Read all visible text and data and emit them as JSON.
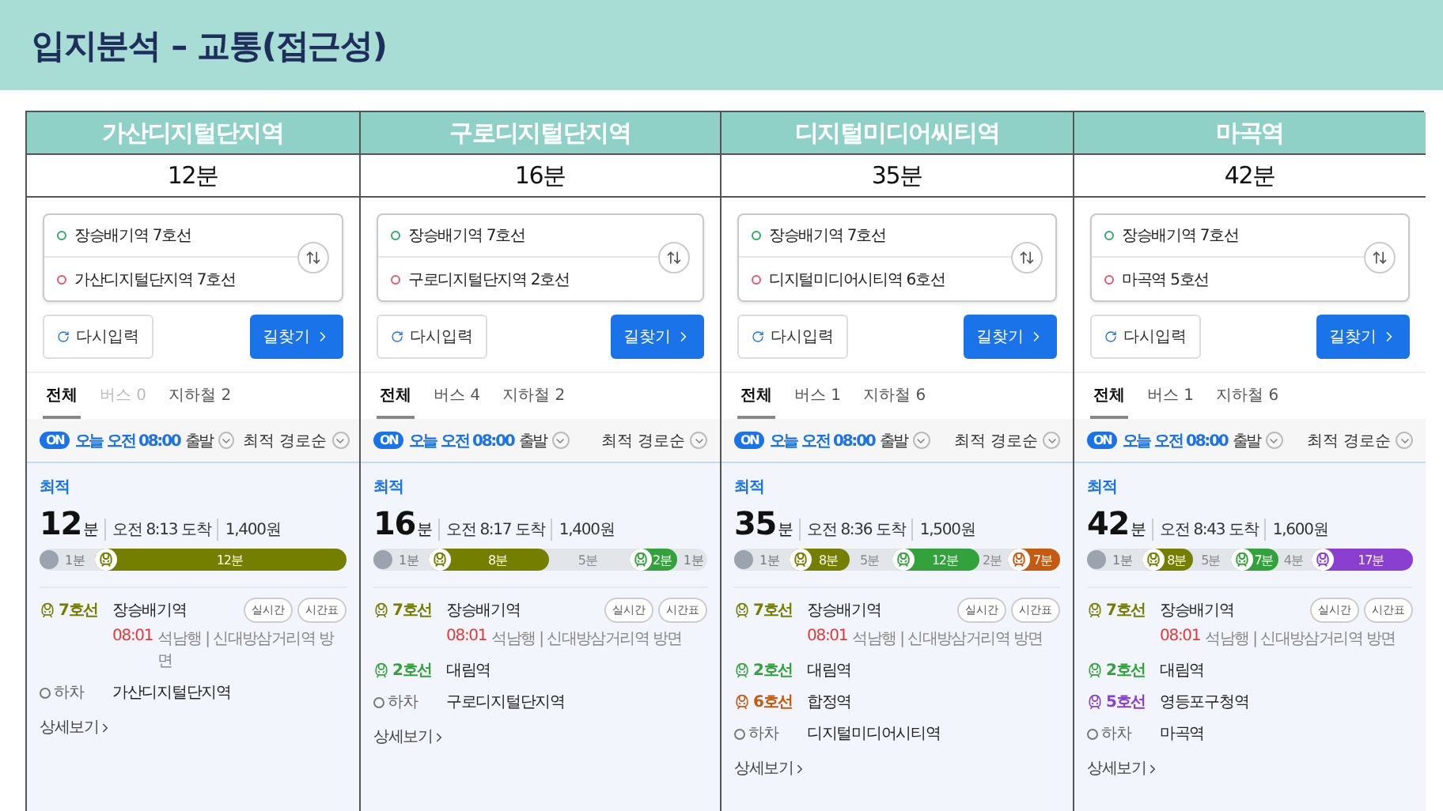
{
  "title": "입지분석 – 교통(접근성)",
  "table": {
    "columns": [
      {
        "header": "가산디지털단지역",
        "travel_time": "12분",
        "screen": {
          "origin": "장승배기역 7호선",
          "destination": "가산디지털단지역 7호선",
          "reset": "다시입력",
          "search": "길찾기",
          "tabs": [
            {
              "label": "전체",
              "selected": true,
              "disabled": false
            },
            {
              "label": "버스 0",
              "selected": false,
              "disabled": true
            },
            {
              "label": "지하철 2",
              "selected": false,
              "disabled": false
            }
          ],
          "on_badge": "ON",
          "depart_time": "오늘 오전 08:00",
          "depart_label": "출발",
          "sort": "최적 경로순",
          "result": {
            "tag": "최적",
            "minutes": "12",
            "unit": "분",
            "arrival": "오전 8:13 도착",
            "fare": "1,400원",
            "segments": [
              {
                "kind": "walk",
                "label": "1분"
              },
              {
                "kind": "ride",
                "label": "12분",
                "color": "#747f00"
              }
            ],
            "steps": [
              {
                "kind": "line",
                "line": "7호선",
                "color": "#747f00",
                "station": "장승배기역",
                "buttons": [
                  "실시간",
                  "시간표"
                ],
                "detail_time": "08:01",
                "detail": "석남행 | 신대방삼거리역 방면"
              },
              {
                "kind": "exit",
                "line": "하차",
                "station": "가산디지털단지역"
              }
            ],
            "more": "상세보기"
          }
        }
      },
      {
        "header": "구로디지털단지역",
        "travel_time": "16분",
        "screen": {
          "origin": "장승배기역 7호선",
          "destination": "구로디지털단지역 2호선",
          "reset": "다시입력",
          "search": "길찾기",
          "tabs": [
            {
              "label": "전체",
              "selected": true,
              "disabled": false
            },
            {
              "label": "버스 4",
              "selected": false,
              "disabled": false
            },
            {
              "label": "지하철 2",
              "selected": false,
              "disabled": false
            }
          ],
          "on_badge": "ON",
          "depart_time": "오늘 오전 08:00",
          "depart_label": "출발",
          "sort": "최적 경로순",
          "result": {
            "tag": "최적",
            "minutes": "16",
            "unit": "분",
            "arrival": "오전 8:17 도착",
            "fare": "1,400원",
            "segments": [
              {
                "kind": "walk",
                "label": "1분"
              },
              {
                "kind": "ride",
                "label": "8분",
                "color": "#747f00"
              },
              {
                "kind": "gap",
                "label": "5분"
              },
              {
                "kind": "ride",
                "label": "2분",
                "color": "#33a23d"
              },
              {
                "kind": "end",
                "label": "1분"
              }
            ],
            "steps": [
              {
                "kind": "line",
                "line": "7호선",
                "color": "#747f00",
                "station": "장승배기역",
                "buttons": [
                  "실시간",
                  "시간표"
                ],
                "detail_time": "08:01",
                "detail": "석남행 | 신대방삼거리역 방면"
              },
              {
                "kind": "line",
                "line": "2호선",
                "color": "#33a23d",
                "station": "대림역"
              },
              {
                "kind": "exit",
                "line": "하차",
                "station": "구로디지털단지역"
              }
            ],
            "more": "상세보기"
          }
        }
      },
      {
        "header": "디지털미디어씨티역",
        "travel_time": "35분",
        "screen": {
          "origin": "장승배기역 7호선",
          "destination": "디지털미디어시티역 6호선",
          "reset": "다시입력",
          "search": "길찾기",
          "tabs": [
            {
              "label": "전체",
              "selected": true,
              "disabled": false
            },
            {
              "label": "버스 1",
              "selected": false,
              "disabled": false
            },
            {
              "label": "지하철 6",
              "selected": false,
              "disabled": false
            }
          ],
          "on_badge": "ON",
          "depart_time": "오늘 오전 08:00",
          "depart_label": "출발",
          "sort": "최적 경로순",
          "result": {
            "tag": "최적",
            "minutes": "35",
            "unit": "분",
            "arrival": "오전 8:36 도착",
            "fare": "1,500원",
            "segments": [
              {
                "kind": "walk",
                "label": "1분"
              },
              {
                "kind": "ride",
                "label": "8분",
                "color": "#747f00"
              },
              {
                "kind": "gap",
                "label": "5분"
              },
              {
                "kind": "ride",
                "label": "12분",
                "color": "#33a23d"
              },
              {
                "kind": "gap",
                "label": "2분"
              },
              {
                "kind": "ride",
                "label": "7분",
                "color": "#c55a11"
              }
            ],
            "steps": [
              {
                "kind": "line",
                "line": "7호선",
                "color": "#747f00",
                "station": "장승배기역",
                "buttons": [
                  "실시간",
                  "시간표"
                ],
                "detail_time": "08:01",
                "detail": "석남행 | 신대방삼거리역 방면"
              },
              {
                "kind": "line",
                "line": "2호선",
                "color": "#33a23d",
                "station": "대림역"
              },
              {
                "kind": "line",
                "line": "6호선",
                "color": "#c55a11",
                "station": "합정역"
              },
              {
                "kind": "exit",
                "line": "하차",
                "station": "디지털미디어시티역"
              }
            ],
            "more": "상세보기"
          }
        }
      },
      {
        "header": "마곡역",
        "travel_time": "42분",
        "screen": {
          "origin": "장승배기역 7호선",
          "destination": "마곡역 5호선",
          "reset": "다시입력",
          "search": "길찾기",
          "tabs": [
            {
              "label": "전체",
              "selected": true,
              "disabled": false
            },
            {
              "label": "버스 1",
              "selected": false,
              "disabled": false
            },
            {
              "label": "지하철 6",
              "selected": false,
              "disabled": false
            }
          ],
          "on_badge": "ON",
          "depart_time": "오늘 오전 08:00",
          "depart_label": "출발",
          "sort": "최적 경로순",
          "result": {
            "tag": "최적",
            "minutes": "42",
            "unit": "분",
            "arrival": "오전 8:43 도착",
            "fare": "1,600원",
            "segments": [
              {
                "kind": "walk",
                "label": "1분"
              },
              {
                "kind": "ride",
                "label": "8분",
                "color": "#747f00"
              },
              {
                "kind": "gap",
                "label": "5분"
              },
              {
                "kind": "ride",
                "label": "7분",
                "color": "#33a23d"
              },
              {
                "kind": "gap",
                "label": "4분"
              },
              {
                "kind": "ride",
                "label": "17분",
                "color": "#8a3fd1"
              }
            ],
            "steps": [
              {
                "kind": "line",
                "line": "7호선",
                "color": "#747f00",
                "station": "장승배기역",
                "buttons": [
                  "실시간",
                  "시간표"
                ],
                "detail_time": "08:01",
                "detail": "석남행 | 신대방삼거리역 방면"
              },
              {
                "kind": "line",
                "line": "2호선",
                "color": "#33a23d",
                "station": "대림역"
              },
              {
                "kind": "line",
                "line": "5호선",
                "color": "#8a3fd1",
                "station": "영등포구청역"
              },
              {
                "kind": "exit",
                "line": "하차",
                "station": "마곡역"
              }
            ],
            "more": "상세보기"
          }
        }
      }
    ]
  }
}
